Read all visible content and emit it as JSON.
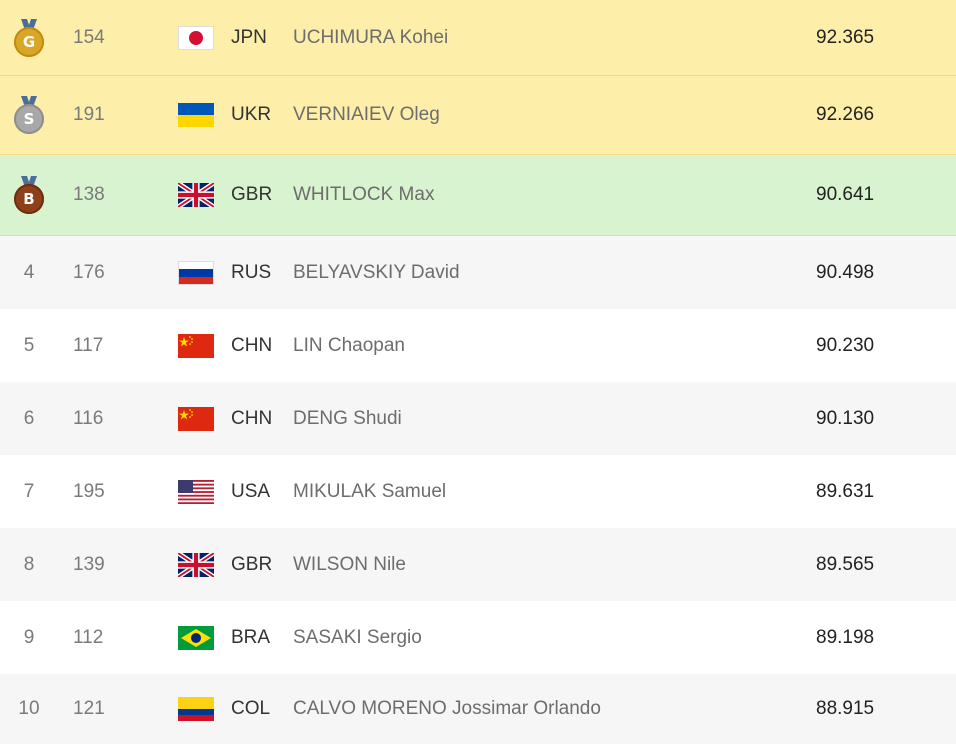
{
  "colors": {
    "gold_row": "#fdeeaa",
    "bronze_row": "#d8f3cf",
    "alt_row": "#f6f6f6",
    "gold_medal": "#d9a626",
    "silver_medal": "#a8a8a8",
    "bronze_medal": "#8f3f1a"
  },
  "rows": [
    {
      "rank": "",
      "medal_letter": "G",
      "medal_icon": "gold-medal-icon",
      "bib": "154",
      "flag_icon": "japan-flag-icon",
      "noc": "JPN",
      "name": "UCHIMURA Kohei",
      "score": "92.365"
    },
    {
      "rank": "",
      "medal_letter": "S",
      "medal_icon": "silver-medal-icon",
      "bib": "191",
      "flag_icon": "ukraine-flag-icon",
      "noc": "UKR",
      "name": "VERNIAIEV Oleg",
      "score": "92.266"
    },
    {
      "rank": "",
      "medal_letter": "B",
      "medal_icon": "bronze-medal-icon",
      "bib": "138",
      "flag_icon": "great-britain-flag-icon",
      "noc": "GBR",
      "name": "WHITLOCK Max",
      "score": "90.641"
    },
    {
      "rank": "4",
      "bib": "176",
      "flag_icon": "russia-flag-icon",
      "noc": "RUS",
      "name": "BELYAVSKIY David",
      "score": "90.498"
    },
    {
      "rank": "5",
      "bib": "117",
      "flag_icon": "china-flag-icon",
      "noc": "CHN",
      "name": "LIN Chaopan",
      "score": "90.230"
    },
    {
      "rank": "6",
      "bib": "116",
      "flag_icon": "china-flag-icon",
      "noc": "CHN",
      "name": "DENG Shudi",
      "score": "90.130"
    },
    {
      "rank": "7",
      "bib": "195",
      "flag_icon": "usa-flag-icon",
      "noc": "USA",
      "name": "MIKULAK Samuel",
      "score": "89.631"
    },
    {
      "rank": "8",
      "bib": "139",
      "flag_icon": "great-britain-flag-icon",
      "noc": "GBR",
      "name": "WILSON Nile",
      "score": "89.565"
    },
    {
      "rank": "9",
      "bib": "112",
      "flag_icon": "brazil-flag-icon",
      "noc": "BRA",
      "name": "SASAKI Sergio",
      "score": "89.198"
    },
    {
      "rank": "10",
      "bib": "121",
      "flag_icon": "colombia-flag-icon",
      "noc": "COL",
      "name": "CALVO MORENO Jossimar Orlando",
      "score": "88.915"
    }
  ]
}
